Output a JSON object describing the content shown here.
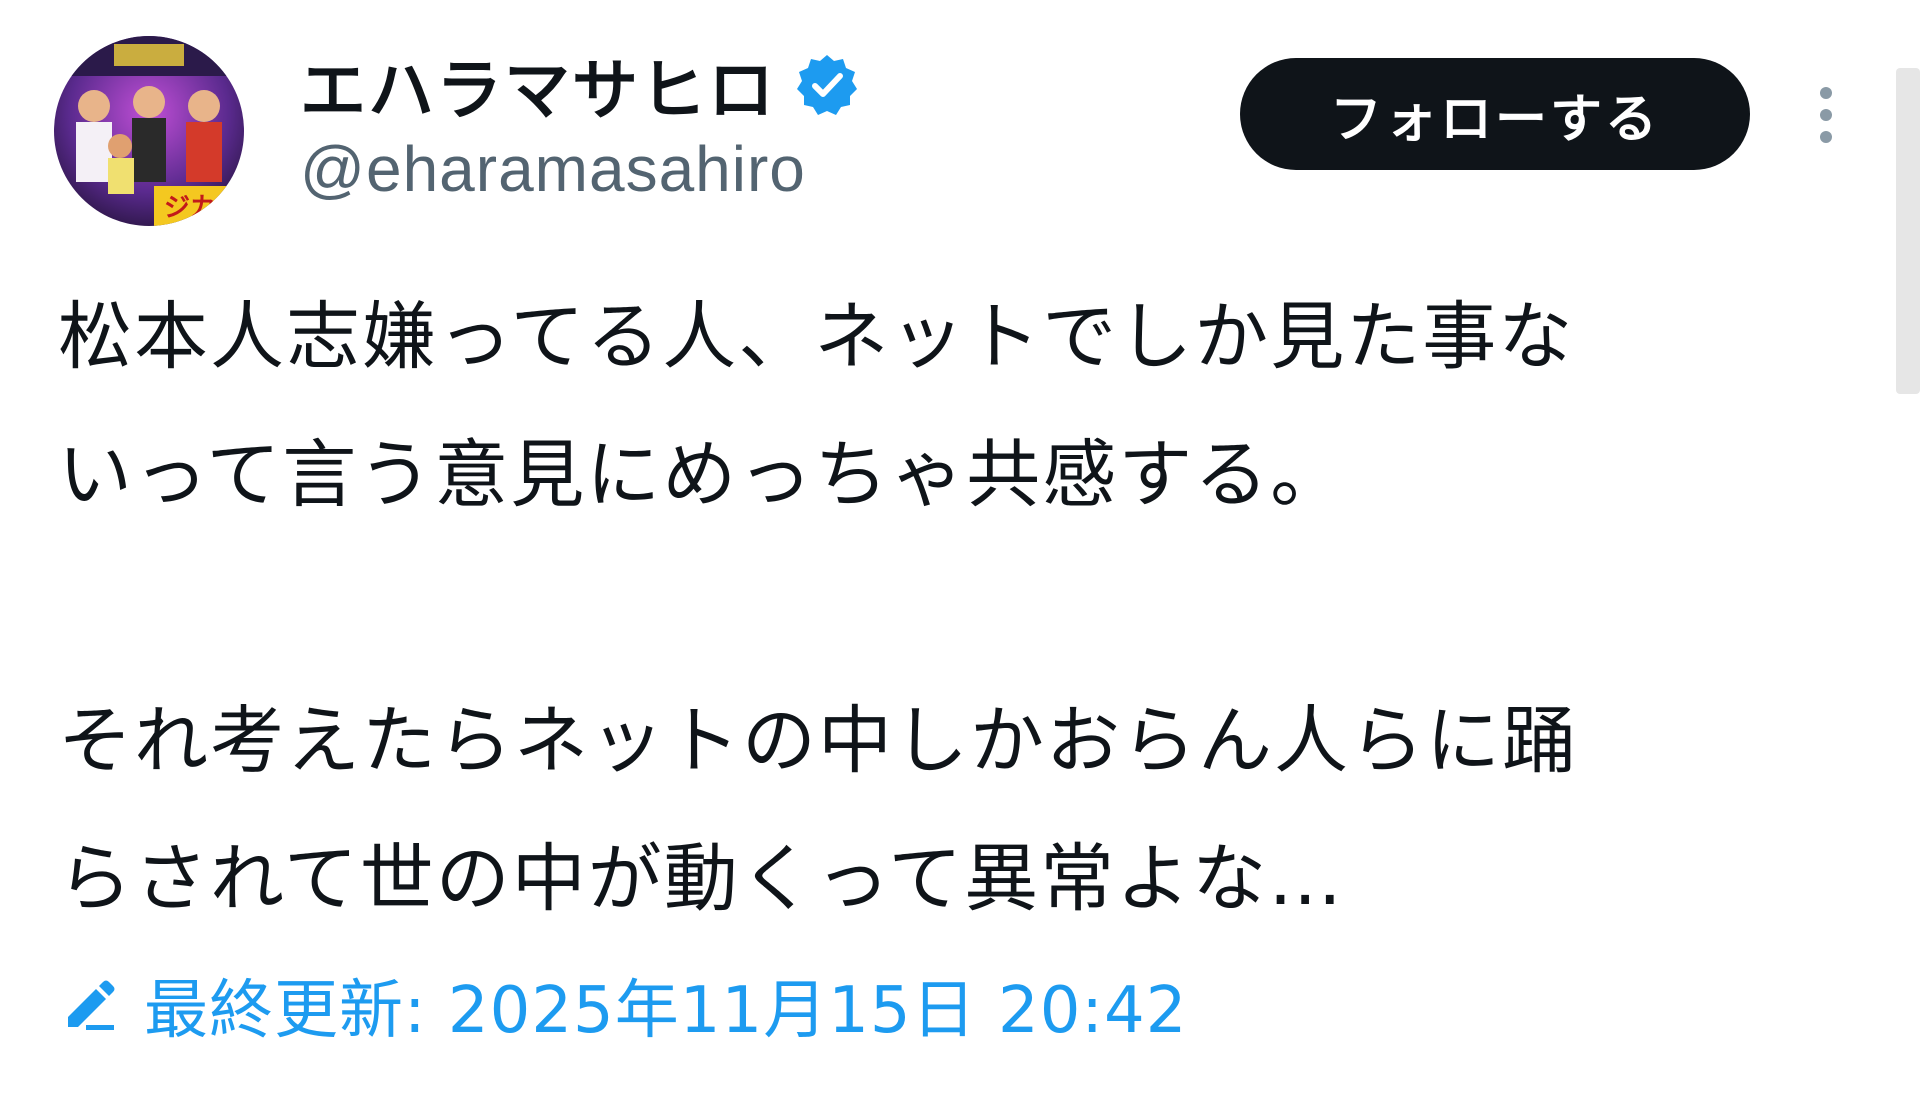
{
  "tweet": {
    "author": {
      "display_name": "エハラマサヒロ",
      "handle": "@eharamasahiro",
      "verified": true,
      "avatar_icon": "profile-photo"
    },
    "follow_label": "フォローする",
    "more_icon": "more-vertical-icon",
    "body": {
      "paragraph1": {
        "line1": "松本人志嫌ってる人、ネットでしか見た事な",
        "line2": "いって言う意見にめっちゃ共感する。"
      },
      "paragraph2": {
        "line1": "それ考えたらネットの中しかおらん人らに踊",
        "line2": "らされて世の中が動くって異常よな…"
      }
    },
    "edited_label": "最終更新: 2025年11月15日 20:42"
  },
  "colors": {
    "text": "#0f1419",
    "secondary": "#536471",
    "accent": "#1d9bf0",
    "button_bg": "#0f1419",
    "button_text": "#ffffff"
  }
}
